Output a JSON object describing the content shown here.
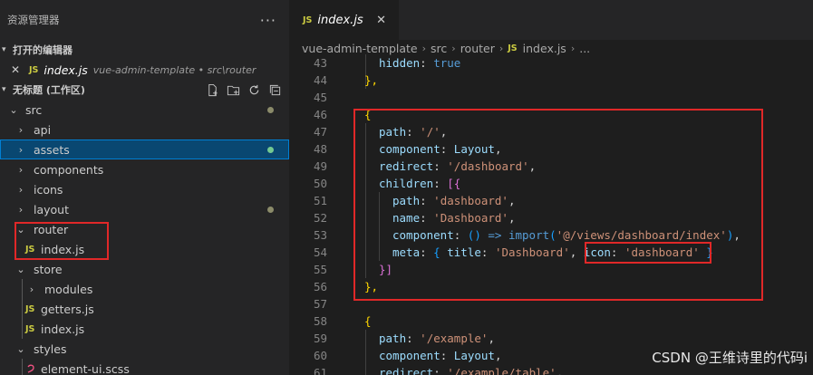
{
  "explorer": {
    "title": "资源管理器",
    "more": "···",
    "open_editors_label": "打开的编辑器",
    "open_editor": {
      "close": "✕",
      "badge": "JS",
      "name": "index.js",
      "description": "vue-admin-template • src\\router"
    },
    "workspace_label": "无标题 (工作区)",
    "tree": [
      {
        "label": "src",
        "badge": "",
        "chevron": "⌄"
      },
      {
        "label": "api",
        "badge": "",
        "chevron": "›"
      },
      {
        "label": "assets",
        "badge": "",
        "chevron": "›"
      },
      {
        "label": "components",
        "badge": "",
        "chevron": "›"
      },
      {
        "label": "icons",
        "badge": "",
        "chevron": "›"
      },
      {
        "label": "layout",
        "badge": "",
        "chevron": "›"
      },
      {
        "label": "router",
        "badge": "",
        "chevron": "⌄"
      },
      {
        "label": "index.js",
        "badge": "JS",
        "chevron": ""
      },
      {
        "label": "store",
        "badge": "",
        "chevron": "⌄"
      },
      {
        "label": "modules",
        "badge": "",
        "chevron": "›"
      },
      {
        "label": "getters.js",
        "badge": "JS",
        "chevron": ""
      },
      {
        "label": "index.js",
        "badge": "JS",
        "chevron": ""
      },
      {
        "label": "styles",
        "badge": "",
        "chevron": "⌄"
      },
      {
        "label": "element-ui.scss",
        "badge": "",
        "chevron": ""
      }
    ]
  },
  "editor": {
    "tab": {
      "badge": "JS",
      "name": "index.js",
      "close": "✕"
    },
    "breadcrumb": {
      "items": [
        "vue-admin-template",
        "src",
        "router"
      ],
      "badge": "JS",
      "file": "index.js",
      "tail": "...",
      "separator": "›"
    },
    "line_numbers": [
      "43",
      "44",
      "45",
      "46",
      "47",
      "48",
      "49",
      "50",
      "51",
      "52",
      "53",
      "54",
      "55",
      "56",
      "57",
      "58",
      "59",
      "60",
      "61"
    ],
    "code": {
      "l43_key": "hidden",
      "l43_colon": ": ",
      "l43_val": "true",
      "l44": "},",
      "l46": "{",
      "l47_key": "path",
      "l47_val": "'/'",
      "l48_key": "component",
      "l48_val": "Layout",
      "l49_key": "redirect",
      "l49_val": "'/dashboard'",
      "l50_key": "children",
      "l50_open": "[{",
      "l51_key": "path",
      "l51_val": "'dashboard'",
      "l52_key": "name",
      "l52_val": "'Dashboard'",
      "l53_key": "component",
      "l53_paren": "()",
      "l53_arrow": "=>",
      "l53_fn": "import",
      "l53_arg": "'@/views/dashboard/index'",
      "l54_key": "meta",
      "l54_title_key": "title",
      "l54_title_val": "'Dashboard'",
      "l54_icon_key": "icon",
      "l54_icon_val": "'dashboard'",
      "l55": "}]",
      "l56": "},",
      "l58": "{",
      "l59_key": "path",
      "l59_val": "'/example'",
      "l60_key": "component",
      "l60_val": "Layout",
      "l61_key": "redirect",
      "l61_val": "'/example/table'"
    }
  },
  "watermark": "CSDN @王维诗里的代码i",
  "colors": {
    "highlight_box": "#e02828",
    "modified_dot": "#8b8b6a",
    "selected_dot": "#73c991"
  }
}
